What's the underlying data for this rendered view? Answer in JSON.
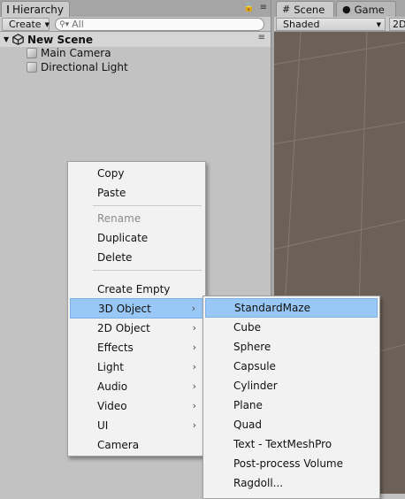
{
  "hierarchy": {
    "tab_label": "Hierarchy",
    "create_label": "Create",
    "search_placeholder": "All",
    "scene_name": "New Scene",
    "items": [
      {
        "label": "Main Camera"
      },
      {
        "label": "Directional Light"
      }
    ]
  },
  "scene_panel": {
    "tab_scene": "Scene",
    "tab_game": "Game",
    "shading_mode": "Shaded",
    "mode_2d": "2D"
  },
  "context_menu": {
    "items": [
      {
        "label": "Copy",
        "enabled": true
      },
      {
        "label": "Paste",
        "enabled": true
      },
      {
        "label": "Rename",
        "enabled": false
      },
      {
        "label": "Duplicate",
        "enabled": true
      },
      {
        "label": "Delete",
        "enabled": true
      },
      {
        "label": "Create Empty",
        "enabled": true
      },
      {
        "label": "3D Object",
        "enabled": true,
        "submenu": true,
        "selected": true
      },
      {
        "label": "2D Object",
        "enabled": true,
        "submenu": true
      },
      {
        "label": "Effects",
        "enabled": true,
        "submenu": true
      },
      {
        "label": "Light",
        "enabled": true,
        "submenu": true
      },
      {
        "label": "Audio",
        "enabled": true,
        "submenu": true
      },
      {
        "label": "Video",
        "enabled": true,
        "submenu": true
      },
      {
        "label": "UI",
        "enabled": true,
        "submenu": true
      },
      {
        "label": "Camera",
        "enabled": true
      }
    ]
  },
  "submenu_3d": {
    "items": [
      {
        "label": "StandardMaze",
        "selected": true
      },
      {
        "label": "Cube"
      },
      {
        "label": "Sphere"
      },
      {
        "label": "Capsule"
      },
      {
        "label": "Cylinder"
      },
      {
        "label": "Plane"
      },
      {
        "label": "Quad"
      },
      {
        "label": "Text - TextMeshPro"
      },
      {
        "label": "Post-process Volume"
      },
      {
        "label": "Ragdoll..."
      }
    ]
  },
  "colors": {
    "panel_bg": "#c2c2c2",
    "menu_bg": "#f2f2f2",
    "highlight": "#99c8f6",
    "scene_viewport": "#6b6158",
    "grid_line": "#83796f"
  }
}
